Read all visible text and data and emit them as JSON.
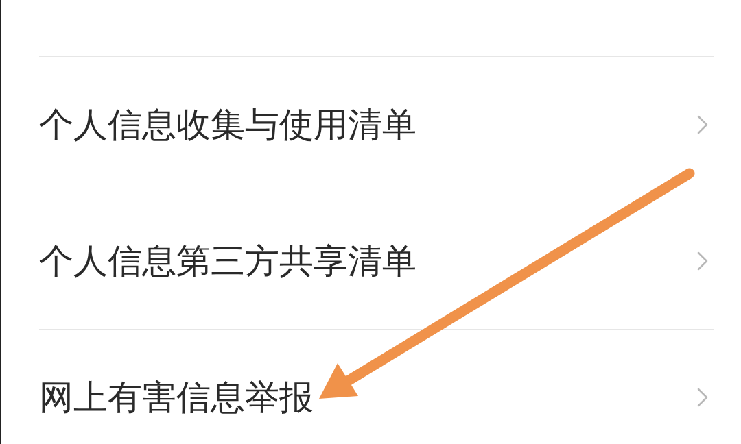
{
  "rows": [
    {
      "label": "个人信息收集与使用清单",
      "chevron": true
    },
    {
      "label": "个人信息第三方共享清单",
      "chevron": true
    },
    {
      "label": "网上有害信息举报",
      "chevron": true
    }
  ],
  "annotation": {
    "kind": "arrow"
  }
}
